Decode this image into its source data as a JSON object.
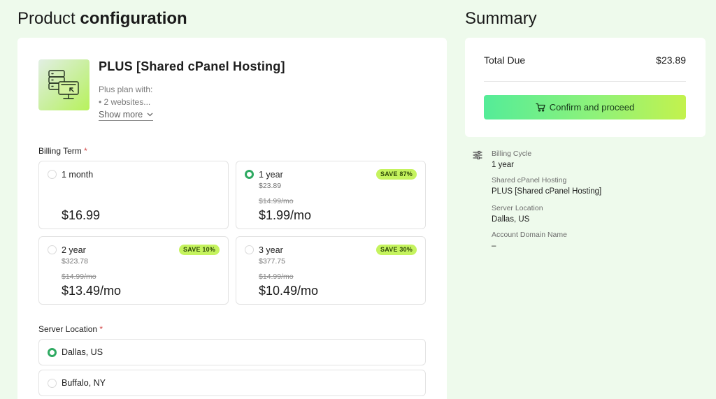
{
  "page": {
    "title_regular": "Product ",
    "title_bold": "configuration",
    "summary_title": "Summary"
  },
  "product": {
    "name": "PLUS [Shared cPanel Hosting]",
    "desc_line1": "Plus plan with:",
    "desc_line2": "• 2 websites...",
    "show_more": "Show more"
  },
  "billing": {
    "label": "Billing Term",
    "required_mark": "*",
    "options": [
      {
        "label": "1 month",
        "total": "",
        "old_price": "",
        "price": "$16.99",
        "badge": "",
        "selected": false
      },
      {
        "label": "1 year",
        "total": "$23.89",
        "old_price": "$14.99/mo",
        "price": "$1.99/mo",
        "badge": "SAVE 87%",
        "selected": true
      },
      {
        "label": "2 year",
        "total": "$323.78",
        "old_price": "$14.99/mo",
        "price": "$13.49/mo",
        "badge": "SAVE 10%",
        "selected": false
      },
      {
        "label": "3 year",
        "total": "$377.75",
        "old_price": "$14.99/mo",
        "price": "$10.49/mo",
        "badge": "SAVE 30%",
        "selected": false
      }
    ]
  },
  "location": {
    "label": "Server Location",
    "required_mark": "*",
    "options": [
      {
        "label": "Dallas, US",
        "selected": true
      },
      {
        "label": "Buffalo, NY",
        "selected": false
      }
    ]
  },
  "summary": {
    "total_label": "Total Due",
    "total_value": "$23.89",
    "confirm_label": "Confirm and proceed",
    "details": [
      {
        "key": "Billing Cycle",
        "value": "1 year"
      },
      {
        "key": "Shared cPanel Hosting",
        "value": "PLUS [Shared cPanel Hosting]"
      },
      {
        "key": "Server Location",
        "value": "Dallas, US"
      },
      {
        "key": "Account Domain Name",
        "value": "–"
      }
    ]
  },
  "icons": {
    "product": "server-screens-icon",
    "cart": "cart-icon",
    "sliders": "sliders-icon",
    "chevron": "chevron-down-icon"
  },
  "colors": {
    "page_bg": "#eefaec",
    "radio_selected": "#2faa62",
    "badge_bg": "#c5f35e",
    "button_gradient_start": "#54ec98",
    "button_gradient_end": "#c3f24d",
    "required": "#d34b4b"
  }
}
